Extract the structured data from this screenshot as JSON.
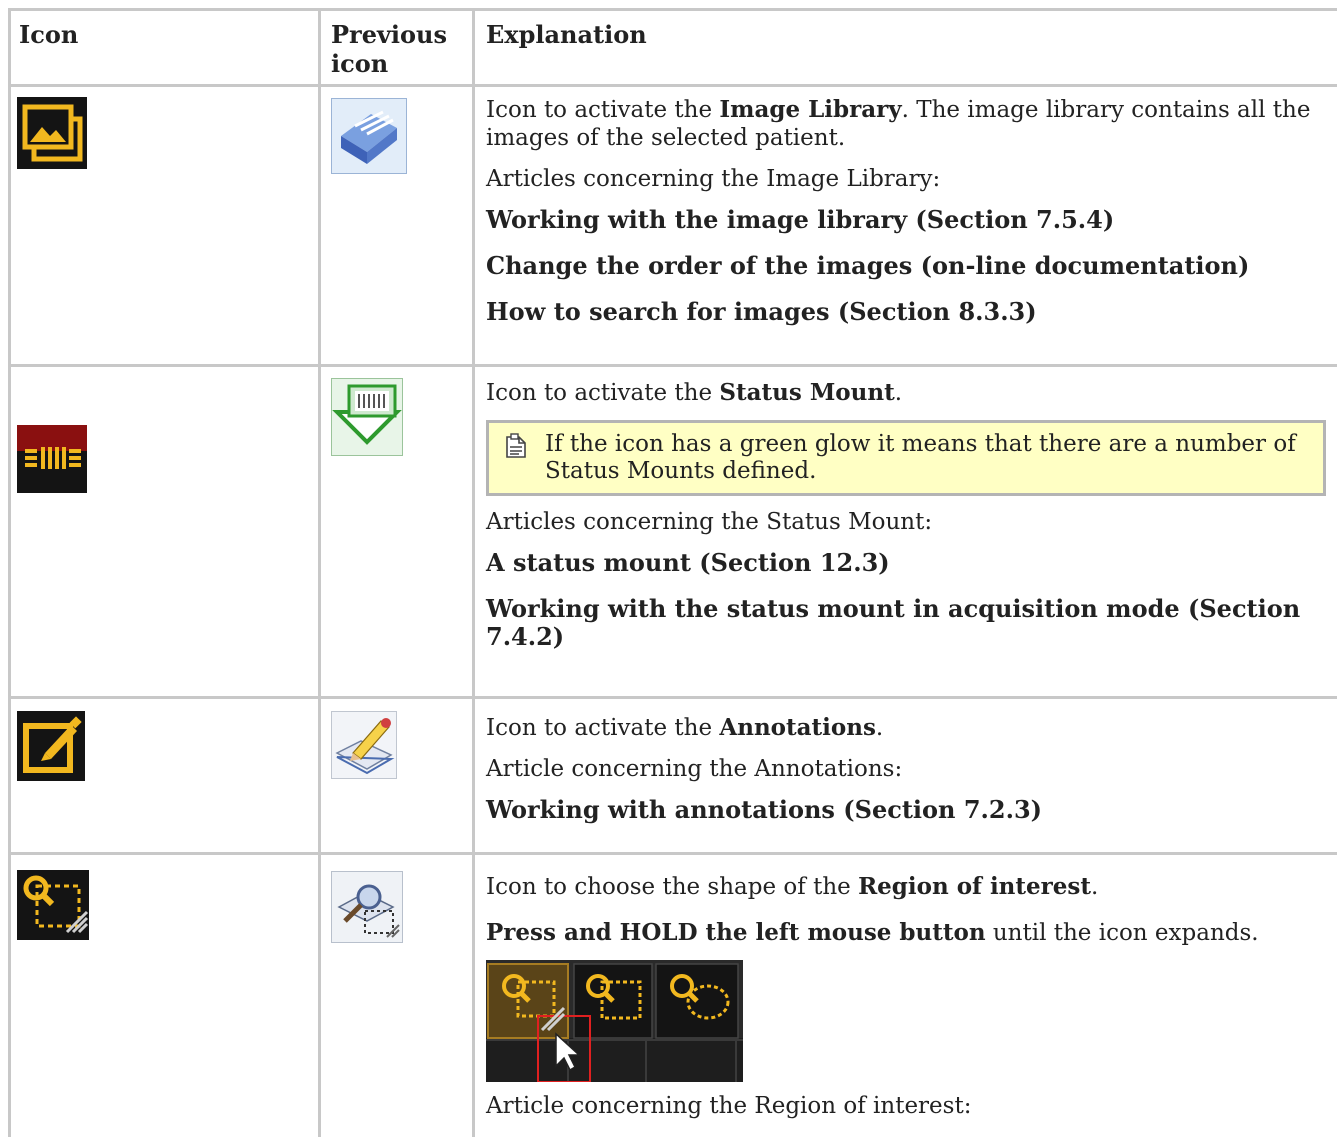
{
  "header": {
    "col_icon": "Icon",
    "col_prev": "Previous icon",
    "col_expl": "Explanation"
  },
  "rows": [
    {
      "icon": "image-library-icon",
      "prev_icon": "image-library-previous-icon",
      "intro_pre": "Icon to activate the ",
      "intro_bold": "Image Library",
      "intro_post": ". The image library contains all the images of the selected patient.",
      "articles_label": "Articles concerning the Image Library:",
      "links": [
        "Working with the image library (Section 7.5.4)",
        "Change the order of the images (on-line documentation)",
        "How to search for images (Section 8.3.3)"
      ]
    },
    {
      "icon": "status-mount-icon",
      "prev_icon": "status-mount-previous-icon",
      "intro_pre": "Icon to activate the ",
      "intro_bold": "Status Mount",
      "intro_post": ".",
      "note": "If the icon has a green glow it means that there are a number of Status Mounts defined.",
      "note_icon": "note-icon",
      "articles_label": "Articles concerning the Status Mount:",
      "links": [
        "A status mount (Section 12.3)",
        "Working with the status mount in acquisition mode (Section 7.4.2)"
      ]
    },
    {
      "icon": "annotations-icon",
      "prev_icon": "annotations-previous-icon",
      "intro_pre": "Icon to activate the ",
      "intro_bold": "Annotations",
      "intro_post": ".",
      "articles_label": "Article concerning the Annotations:",
      "links": [
        "Working with annotations (Section 7.2.3)"
      ]
    },
    {
      "icon": "region-of-interest-icon",
      "prev_icon": "region-of-interest-previous-icon",
      "intro_pre": "Icon to choose the shape of the ",
      "intro_bold": "Region of interest",
      "intro_post": ".",
      "hold_bold": "Press and HOLD the left mouse button",
      "hold_post": " until the icon expands.",
      "screenshot": "roi-expanded-toolbar-screenshot",
      "articles_label": "Article concerning the Region of interest:"
    }
  ],
  "colors": {
    "border": "#c8c8c8",
    "note_bg": "#ffffc4",
    "icon_gold": "#f2b81f",
    "icon_dark": "#141414"
  }
}
